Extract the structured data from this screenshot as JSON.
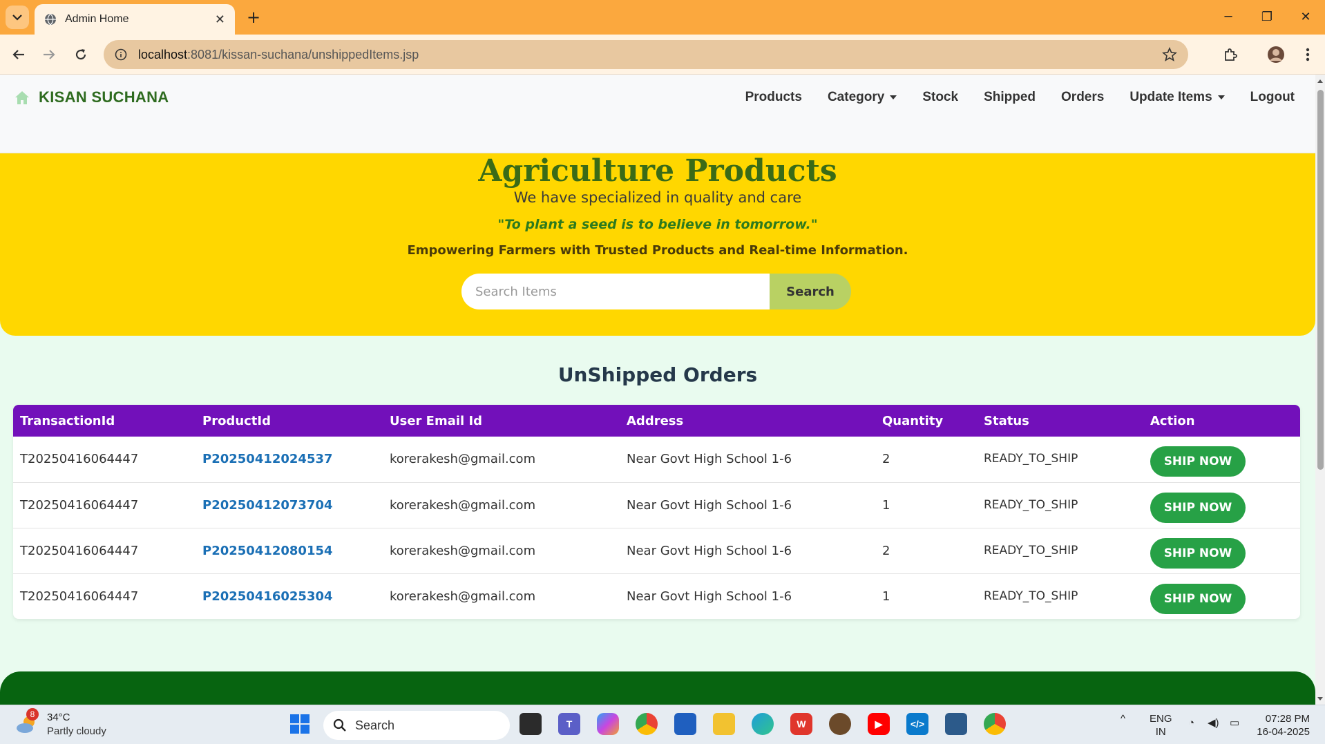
{
  "browser": {
    "tab_title": "Admin Home",
    "url_host": "localhost",
    "url_path": ":8081/kissan-suchana/unshippedItems.jsp"
  },
  "navbar": {
    "brand": "KISAN SUCHANA",
    "links": {
      "products": "Products",
      "category": "Category",
      "stock": "Stock",
      "shipped": "Shipped",
      "orders": "Orders",
      "update_items": "Update Items",
      "logout": "Logout"
    }
  },
  "hero": {
    "title": "Agriculture Products",
    "subtitle": "We have specialized in quality and care",
    "quote": "\"To plant a seed is to believe in tomorrow.\"",
    "tagline": "Empowering Farmers with Trusted Products and Real-time Information.",
    "search_placeholder": "Search Items",
    "search_button": "Search"
  },
  "orders": {
    "title": "UnShipped Orders",
    "columns": {
      "transaction": "TransactionId",
      "product": "ProductId",
      "email": "User Email Id",
      "address": "Address",
      "quantity": "Quantity",
      "status": "Status",
      "action": "Action"
    },
    "rows": [
      {
        "transaction_id": "T20250416064447",
        "product_id": "P20250412024537",
        "email": "korerakesh@gmail.com",
        "address": "Near Govt High School 1-6",
        "quantity": "2",
        "status": "READY_TO_SHIP",
        "action": "SHIP NOW"
      },
      {
        "transaction_id": "T20250416064447",
        "product_id": "P20250412073704",
        "email": "korerakesh@gmail.com",
        "address": "Near Govt High School 1-6",
        "quantity": "1",
        "status": "READY_TO_SHIP",
        "action": "SHIP NOW"
      },
      {
        "transaction_id": "T20250416064447",
        "product_id": "P20250412080154",
        "email": "korerakesh@gmail.com",
        "address": "Near Govt High School 1-6",
        "quantity": "2",
        "status": "READY_TO_SHIP",
        "action": "SHIP NOW"
      },
      {
        "transaction_id": "T20250416064447",
        "product_id": "P20250416025304",
        "email": "korerakesh@gmail.com",
        "address": "Near Govt High School 1-6",
        "quantity": "1",
        "status": "READY_TO_SHIP",
        "action": "SHIP NOW"
      }
    ]
  },
  "taskbar": {
    "weather_temp": "34°C",
    "weather_desc": "Partly cloudy",
    "weather_badge": "8",
    "search_label": "Search",
    "lang": "ENG",
    "region": "IN",
    "time": "07:28 PM",
    "date": "16-04-2025"
  },
  "colors": {
    "tabbar": "#fba83e",
    "hero": "#ffd700",
    "table_header": "#7210ba",
    "ship_button": "#27a146",
    "footer": "#076410",
    "brand": "#2e6b1f"
  }
}
